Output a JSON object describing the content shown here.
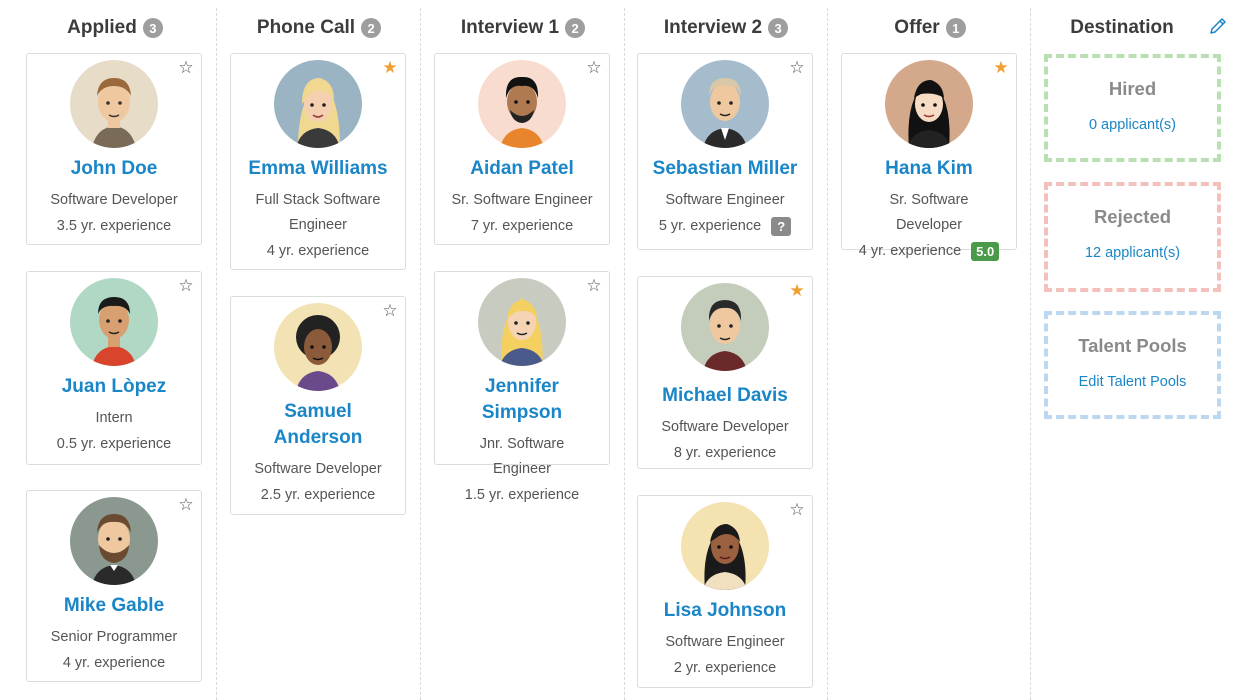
{
  "columns": [
    {
      "title": "Applied",
      "count": "3"
    },
    {
      "title": "Phone Call",
      "count": "2"
    },
    {
      "title": "Interview 1",
      "count": "2"
    },
    {
      "title": "Interview 2",
      "count": "3"
    },
    {
      "title": "Offer",
      "count": "1"
    }
  ],
  "candidates": {
    "john": {
      "name": "John Doe",
      "title": "Software Developer",
      "experience": "3.5 yr. experience",
      "starred": false
    },
    "juan": {
      "name": "Juan Lòpez",
      "title": "Intern",
      "experience": "0.5 yr. experience",
      "starred": false
    },
    "mike": {
      "name": "Mike Gable",
      "title": "Senior Programmer",
      "experience": "4 yr. experience",
      "starred": false
    },
    "emma": {
      "name": "Emma Williams",
      "title": "Full Stack Software Engineer",
      "experience": "4 yr. experience",
      "starred": true
    },
    "samuel": {
      "name": "Samuel Anderson",
      "title": "Software Developer",
      "experience": "2.5 yr. experience",
      "starred": false
    },
    "aidan": {
      "name": "Aidan Patel",
      "title": "Sr. Software Engineer",
      "experience": "7 yr. experience",
      "starred": false
    },
    "jennifer": {
      "name": "Jennifer Simpson",
      "title": "Jnr. Software Engineer",
      "experience": "1.5 yr. experience",
      "starred": false
    },
    "sebastian": {
      "name": "Sebastian Miller",
      "title": "Software Engineer",
      "experience": "5 yr. experience",
      "starred": false,
      "badge": "?"
    },
    "michael": {
      "name": "Michael Davis",
      "title": "Software Developer",
      "experience": "8 yr. experience",
      "starred": true
    },
    "lisa": {
      "name": "Lisa Johnson",
      "title": "Software Engineer",
      "experience": "2 yr. experience",
      "starred": false
    },
    "hana": {
      "name": "Hana Kim",
      "title": "Sr. Software Developer",
      "experience": "4 yr. experience",
      "starred": true,
      "score": "5.0"
    }
  },
  "destination": {
    "title": "Destination",
    "hired": {
      "title": "Hired",
      "link": "0 applicant(s)",
      "color": "#b8e0b0"
    },
    "rejected": {
      "title": "Rejected",
      "link": "12 applicant(s)",
      "color": "#f4c0bc"
    },
    "talent_pools": {
      "title": "Talent Pools",
      "link": "Edit Talent Pools",
      "color": "#bcd8f0"
    }
  },
  "icons": {
    "star_empty": "star-outline-icon",
    "star_filled": "star-filled-icon",
    "edit": "pencil-icon"
  },
  "colors": {
    "link": "#1a86c8",
    "star_on": "#f0a030",
    "score": "#4a9a4a",
    "count_badge": "#9e9e9e"
  }
}
